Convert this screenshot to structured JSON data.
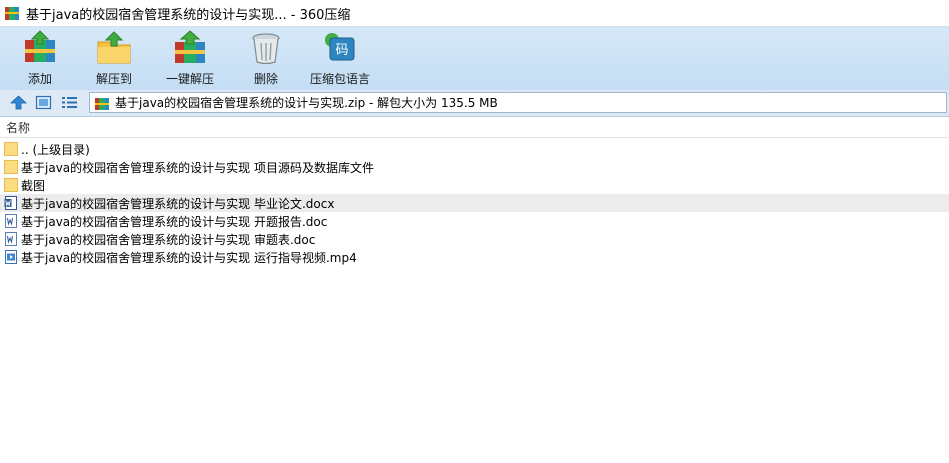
{
  "window": {
    "title": "基于java的校园宿舍管理系统的设计与实现... - 360压缩"
  },
  "toolbar": {
    "add_label": "添加",
    "extract_to_label": "解压到",
    "one_click_extract_label": "一键解压",
    "delete_label": "删除",
    "archive_language_label": "压缩包语言",
    "archive_language_icon_text": "码"
  },
  "addressbar": {
    "path": "基于java的校园宿舍管理系统的设计与实现.zip - 解包大小为 135.5 MB"
  },
  "list": {
    "column_name": "名称",
    "items": [
      {
        "name": ".. (上级目录)",
        "type": "folder"
      },
      {
        "name": "基于java的校园宿舍管理系统的设计与实现 项目源码及数据库文件",
        "type": "folder"
      },
      {
        "name": "截图",
        "type": "folder"
      },
      {
        "name": "基于java的校园宿舍管理系统的设计与实现 毕业论文.docx",
        "type": "docx",
        "selected": true
      },
      {
        "name": "基于java的校园宿舍管理系统的设计与实现 开题报告.doc",
        "type": "doc"
      },
      {
        "name": "基于java的校园宿舍管理系统的设计与实现 审题表.doc",
        "type": "doc"
      },
      {
        "name": "基于java的校园宿舍管理系统的设计与实现 运行指导视频.mp4",
        "type": "mp4"
      }
    ]
  }
}
